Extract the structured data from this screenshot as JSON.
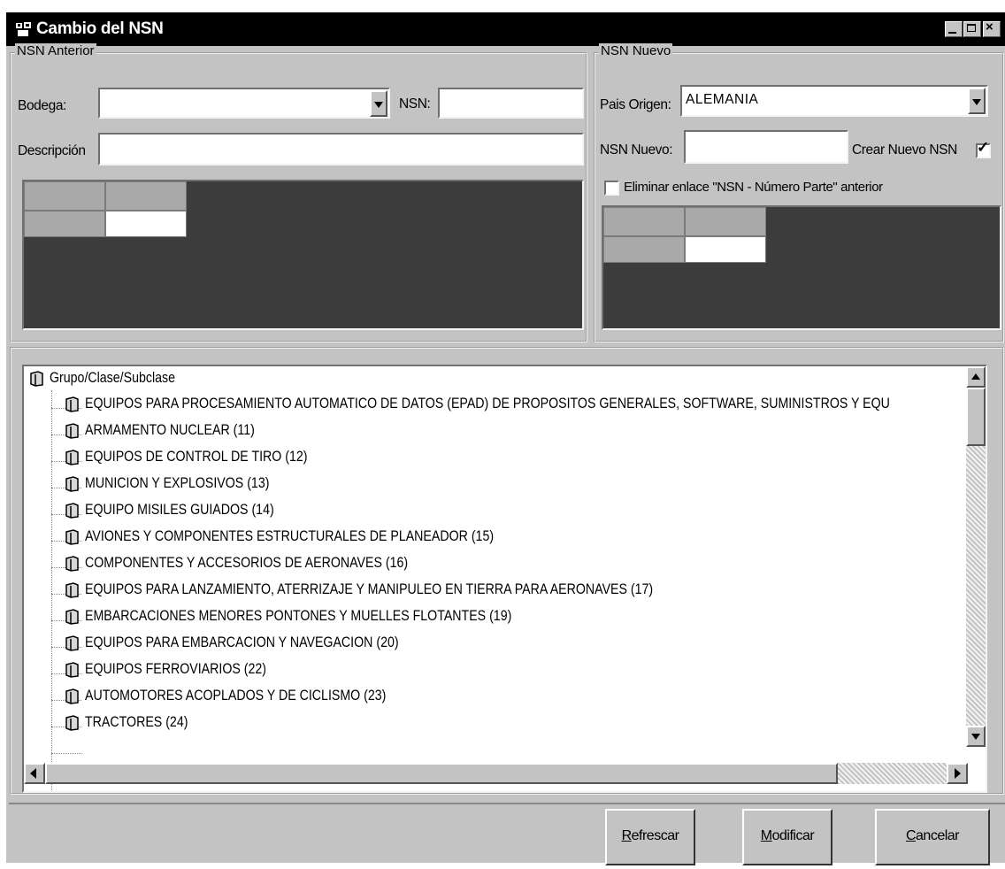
{
  "window": {
    "title": "Cambio del NSN"
  },
  "nsn_anterior": {
    "group_label": "NSN Anterior",
    "bodega_label": "Bodega:",
    "bodega_value": "",
    "nsn_label": "NSN:",
    "nsn_value": "",
    "descripcion_label": "Descripción",
    "descripcion_value": ""
  },
  "nsn_nuevo": {
    "group_label": "NSN Nuevo",
    "pais_label": "Pais Origen:",
    "pais_value": "ALEMANIA",
    "nsn_nuevo_label": "NSN Nuevo:",
    "nsn_nuevo_value": "",
    "crear_label": "Crear Nuevo NSN",
    "crear_checked": true,
    "eliminar_label": "Eliminar enlace \"NSN - Número Parte\" anterior",
    "eliminar_checked": false
  },
  "tree": {
    "root": "Grupo/Clase/Subclase",
    "items": [
      "EQUIPOS PARA PROCESAMIENTO AUTOMATICO DE DATOS (EPAD) DE PROPOSITOS GENERALES, SOFTWARE, SUMINISTROS Y EQU",
      "ARMAMENTO NUCLEAR (11)",
      "EQUIPOS DE CONTROL DE TIRO (12)",
      "MUNICION Y EXPLOSIVOS (13)",
      "EQUIPO MISILES GUIADOS (14)",
      "AVIONES Y COMPONENTES ESTRUCTURALES DE PLANEADOR (15)",
      "COMPONENTES Y ACCESORIOS DE AERONAVES (16)",
      "EQUIPOS PARA LANZAMIENTO, ATERRIZAJE Y MANIPULEO EN TIERRA  PARA AERONAVES (17)",
      "EMBARCACIONES MENORES PONTONES Y MUELLES FLOTANTES (19)",
      "EQUIPOS PARA EMBARCACION Y NAVEGACION (20)",
      "EQUIPOS FERROVIARIOS (22)",
      "AUTOMOTORES ACOPLADOS Y DE CICLISMO (23)",
      "TRACTORES (24)"
    ]
  },
  "buttons": {
    "refrescar_first": "R",
    "refrescar_rest": "efrescar",
    "modificar_first": "M",
    "modificar_rest": "odificar",
    "cancelar_first": "C",
    "cancelar_rest": "ancelar"
  }
}
